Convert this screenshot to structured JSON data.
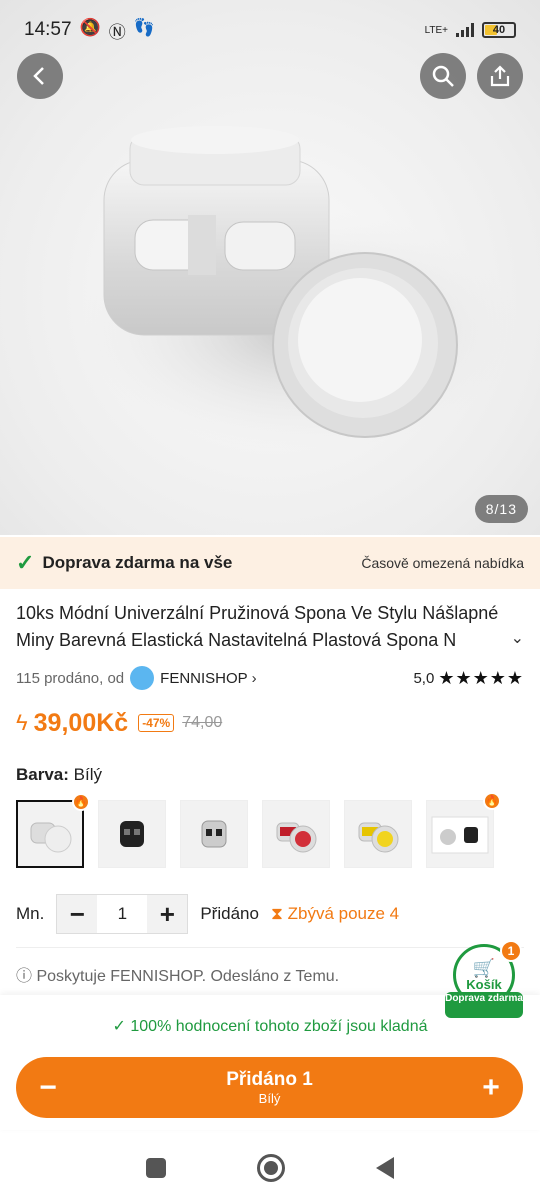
{
  "status_bar": {
    "time": "14:57",
    "network": "LTE+",
    "battery": "40"
  },
  "gallery": {
    "counter": "8/13"
  },
  "shipping": {
    "main": "Doprava zdarma na vše",
    "promo": "Časově omezená nabídka"
  },
  "product": {
    "title_main": "10ks Módní Univerzální Pružinová Spona Ve Stylu Nášlapné Miny Barevná Elastická Nastavitelná Plastová Spona N",
    "sold": "115 prodáno, od",
    "shop": "FENNISHOP",
    "rating": "5,0",
    "price": "39,00Kč",
    "discount": "-47%",
    "old_price": "74,00"
  },
  "variant": {
    "label": "Barva:",
    "value": "Bílý",
    "swatches": [
      "white",
      "black",
      "clear-black",
      "red",
      "yellow",
      "photo"
    ]
  },
  "quantity": {
    "label": "Mn.",
    "value": "1",
    "added": "Přidáno",
    "remaining": "Zbývá pouze 4"
  },
  "provider": "Poskytuje FENNISHOP. Odesláno z Temu.",
  "cart": {
    "count": "1",
    "label": "Košík",
    "free": "Doprava zdarma"
  },
  "reviews_note": "100% hodnocení tohoto zboží jsou kladná",
  "cta": {
    "title": "Přidáno 1",
    "subtitle": "Bílý"
  },
  "colors": {
    "accent": "#f27a13",
    "green": "#1f9a3f"
  }
}
